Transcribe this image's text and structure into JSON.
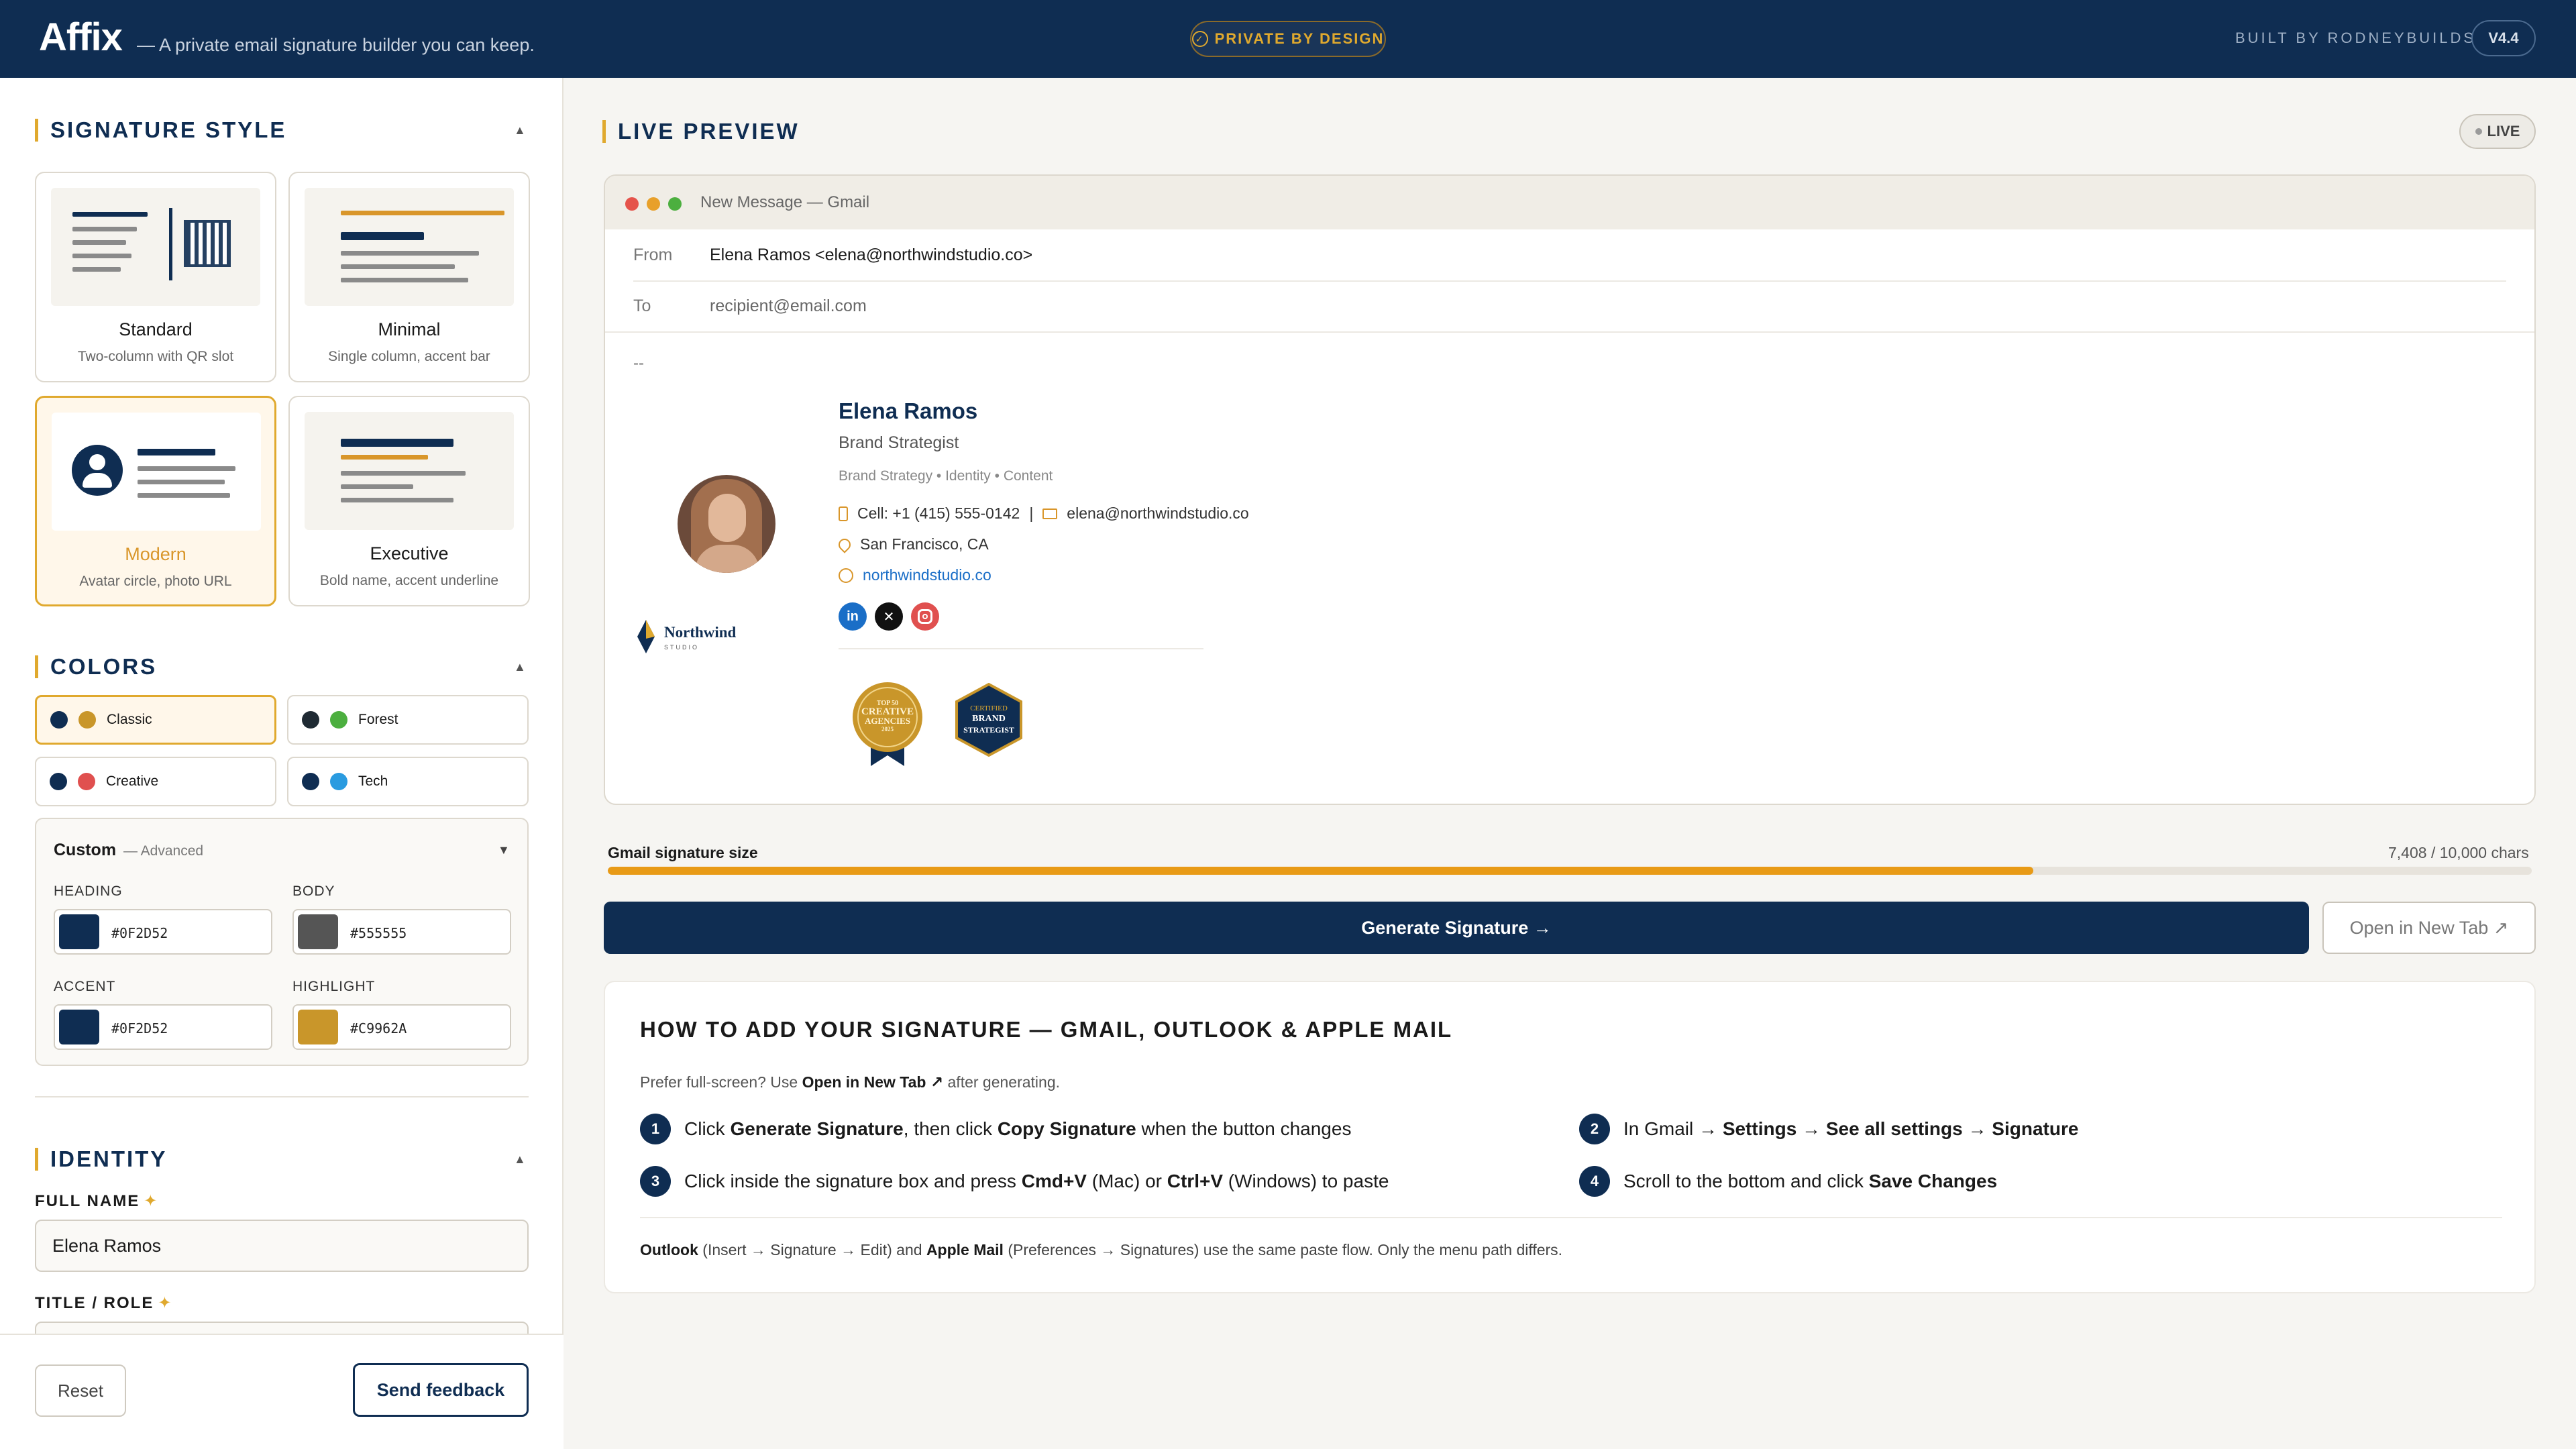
{
  "header": {
    "brand": "Affix",
    "tagline": "— A private email signature builder you can keep.",
    "privacy_badge": "PRIVATE BY DESIGN",
    "built_by": "BUILT BY RODNEYBUILDS",
    "version": "V4.4"
  },
  "sidebar": {
    "signature_style": {
      "heading": "SIGNATURE STYLE",
      "options": [
        {
          "name": "Standard",
          "desc": "Two-column with QR slot",
          "selected": false
        },
        {
          "name": "Minimal",
          "desc": "Single column, accent bar",
          "selected": false
        },
        {
          "name": "Modern",
          "desc": "Avatar circle, photo URL",
          "selected": true
        },
        {
          "name": "Executive",
          "desc": "Bold name, accent underline",
          "selected": false
        }
      ]
    },
    "colors": {
      "heading": "COLORS",
      "presets": [
        {
          "name": "Classic",
          "dot1": "#0F2D52",
          "dot2": "#C9962A",
          "selected": true
        },
        {
          "name": "Forest",
          "dot1": "#1F2A33",
          "dot2": "#4CAF3F",
          "selected": false
        },
        {
          "name": "Creative",
          "dot1": "#0F2D52",
          "dot2": "#E0504F",
          "selected": false
        },
        {
          "name": "Tech",
          "dot1": "#0F2D52",
          "dot2": "#2A9BE0",
          "selected": false
        }
      ],
      "custom": {
        "title": "Custom",
        "subtitle": "— Advanced",
        "heading_label": "HEADING",
        "heading_value": "#0F2D52",
        "body_label": "BODY",
        "body_value": "#555555",
        "accent_label": "ACCENT",
        "accent_value": "#0F2D52",
        "highlight_label": "HIGHLIGHT",
        "highlight_value": "#C9962A"
      }
    },
    "identity": {
      "heading": "IDENTITY",
      "full_name_label": "FULL NAME",
      "full_name_value": "Elena Ramos",
      "title_label": "TITLE / ROLE",
      "required_mark": "✦"
    },
    "footer": {
      "reset": "Reset",
      "feedback": "Send feedback"
    }
  },
  "preview": {
    "heading": "LIVE PREVIEW",
    "live_badge": "LIVE",
    "window_title": "New Message — Gmail",
    "from_label": "From",
    "from_value": "Elena Ramos <elena@northwindstudio.co>",
    "to_label": "To",
    "to_value": "recipient@email.com",
    "separator": "--",
    "signature": {
      "name": "Elena Ramos",
      "title": "Brand Strategist",
      "tags": "Brand Strategy • Identity • Content",
      "phone": "Cell: +1 (415) 555-0142",
      "pipe": "|",
      "email": "elena@northwindstudio.co",
      "location": "San Francisco, CA",
      "website": "northwindstudio.co",
      "company": "Northwind",
      "company_sub": "STUDIO",
      "badge1_lines": [
        "TOP 50",
        "CREATIVE",
        "AGENCIES",
        "2025"
      ],
      "badge2_lines": [
        "CERTIFIED",
        "BRAND",
        "STRATEGIST"
      ]
    }
  },
  "size_meter": {
    "label": "Gmail signature size",
    "value_text": "7,408 / 10,000 chars",
    "fraction": 0.7408
  },
  "actions": {
    "generate": "Generate Signature →",
    "open_tab": "Open in New Tab ↗"
  },
  "howto": {
    "title": "HOW TO ADD YOUR SIGNATURE — GMAIL, OUTLOOK & APPLE MAIL",
    "pref_pre": "Prefer full-screen? Use",
    "pref_bold": "Open in New Tab ↗",
    "pref_post": "after generating.",
    "steps": [
      {
        "num": "1",
        "a": "Click ",
        "b": "Generate Signature",
        "c": ", then click ",
        "d": "Copy Signature",
        "e": " when the button changes"
      },
      {
        "num": "2",
        "a": "In Gmail → ",
        "b": "Settings",
        "c": " → ",
        "d": "See all settings",
        "e": " → ",
        "f": "Signature"
      },
      {
        "num": "3",
        "a": "Click inside the signature box and press ",
        "b": "Cmd+V",
        "c": " (Mac) or ",
        "d": "Ctrl+V",
        "e": " (Windows) to paste"
      },
      {
        "num": "4",
        "a": "Scroll to the bottom and click ",
        "b": "Save Changes"
      }
    ],
    "note_b1": "Outlook",
    "note_t1": " (Insert → Signature → Edit) and ",
    "note_b2": "Apple Mail",
    "note_t2": " (Preferences → Signatures) use the same paste flow. Only the menu path differs."
  }
}
